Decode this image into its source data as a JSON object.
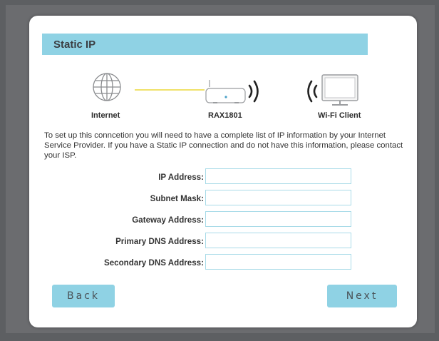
{
  "colors": {
    "accent": "#8fd2e4",
    "connection_line": "#f0e26a",
    "input_border": "#a9dbe8",
    "background": "#5d5f62"
  },
  "header": {
    "title": "Static IP"
  },
  "diagram": {
    "internet_label": "Internet",
    "router_label": "RAX1801",
    "client_label": "Wi-Fi Client",
    "icons": [
      "globe-icon",
      "router-icon",
      "wifi-signal-icon",
      "monitor-icon"
    ]
  },
  "description": "To set up this conncetion you will need to have a complete list of IP information by your Internet Service Provider. If you have a Static IP connection and do not have this information, please contact your ISP.",
  "form": {
    "fields": [
      {
        "label": "IP Address:",
        "value": ""
      },
      {
        "label": "Subnet Mask:",
        "value": ""
      },
      {
        "label": "Gateway Address:",
        "value": ""
      },
      {
        "label": "Primary DNS Address:",
        "value": ""
      },
      {
        "label": "Secondary DNS Address:",
        "value": ""
      }
    ]
  },
  "buttons": {
    "back": "Back",
    "next": "Next"
  }
}
